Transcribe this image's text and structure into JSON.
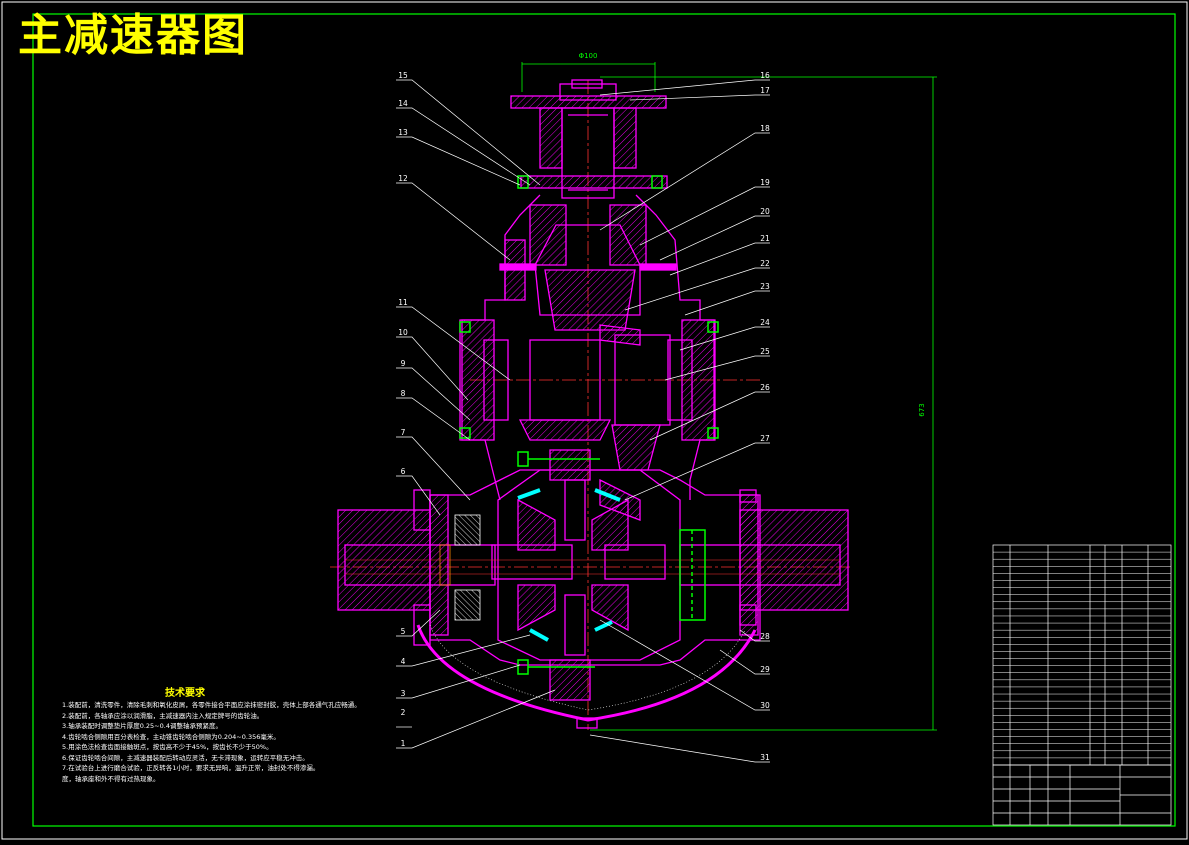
{
  "title": "主减速器图",
  "dimensions": {
    "top_width": "Φ100",
    "height": "673"
  },
  "part_numbers": {
    "left": [
      "15",
      "14",
      "13",
      "12",
      "11",
      "10",
      "9",
      "8",
      "7",
      "6",
      "5",
      "4",
      "3",
      "2",
      "1"
    ],
    "right": [
      "16",
      "17",
      "18",
      "19",
      "20",
      "21",
      "22",
      "23",
      "24",
      "25",
      "26",
      "27",
      "28",
      "29",
      "30",
      "31"
    ]
  },
  "technical_requirements": {
    "heading": "技术要求",
    "items": [
      "1.装配前，清洗零件，清除毛刺和氧化皮屑，各零件接合平面应涂抹密封胶，壳体上部各通气孔应畅通。",
      "2.装配前，各轴承应涂以润滑脂，主减速器内注入规定牌号的齿轮油。",
      "3.轴承装配时调整垫片厚度0.25~0.4调整轴承预紧度。",
      "4.齿轮啮合侧隙用百分表检查，主动锥齿轮啮合侧隙为0.204~0.356毫米。",
      "5.用涂色法检查齿面接触斑点，按齿高不少于45%，按齿长不少于50%。",
      "6.保证齿轮啮合间隙，主减速器装配后转动应灵活，无卡滞现象，运转应平稳无冲击。",
      "7.在试验台上进行磨合试验，正反转各1小时，要求无异响，温升正常，油封处不得渗漏。",
      "度，轴承座和外不得有过热现象。"
    ]
  },
  "colors": {
    "background": "#000000",
    "title": "#ffff00",
    "frame": "#00ff00",
    "outline": "#ff00ff",
    "hatch": "#ff00ff",
    "centerline": "#ff3030",
    "leader": "#ffffff",
    "bolt": "#00ff00",
    "bearing": "#00ffff"
  }
}
